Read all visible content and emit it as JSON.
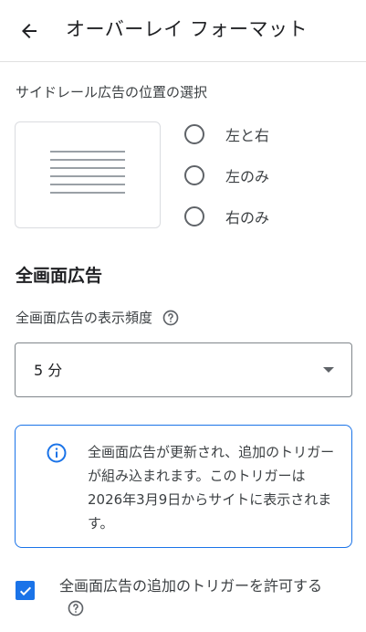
{
  "header": {
    "title": "オーバーレイ フォーマット",
    "back_icon": "arrow-back-icon"
  },
  "sidebar_position": {
    "label": "サイドレール広告の位置の選択",
    "options": [
      {
        "label": "左と右",
        "selected": false
      },
      {
        "label": "左のみ",
        "selected": false
      },
      {
        "label": "右のみ",
        "selected": false
      }
    ]
  },
  "interstitial": {
    "heading": "全画面広告",
    "frequency_label": "全画面広告の表示頻度",
    "frequency_value": "5 分",
    "info_text": "全画面広告が更新され、追加のトリガーが組み込まれます。このトリガーは 2026年3月9日からサイトに表示されます。",
    "checkbox_label": "全画面広告の追加のトリガーを許可する",
    "checkbox_checked": true
  },
  "colors": {
    "accent": "#1a73e8",
    "text_primary": "#202124",
    "text_secondary": "#3c4043",
    "border": "#dadce0"
  }
}
